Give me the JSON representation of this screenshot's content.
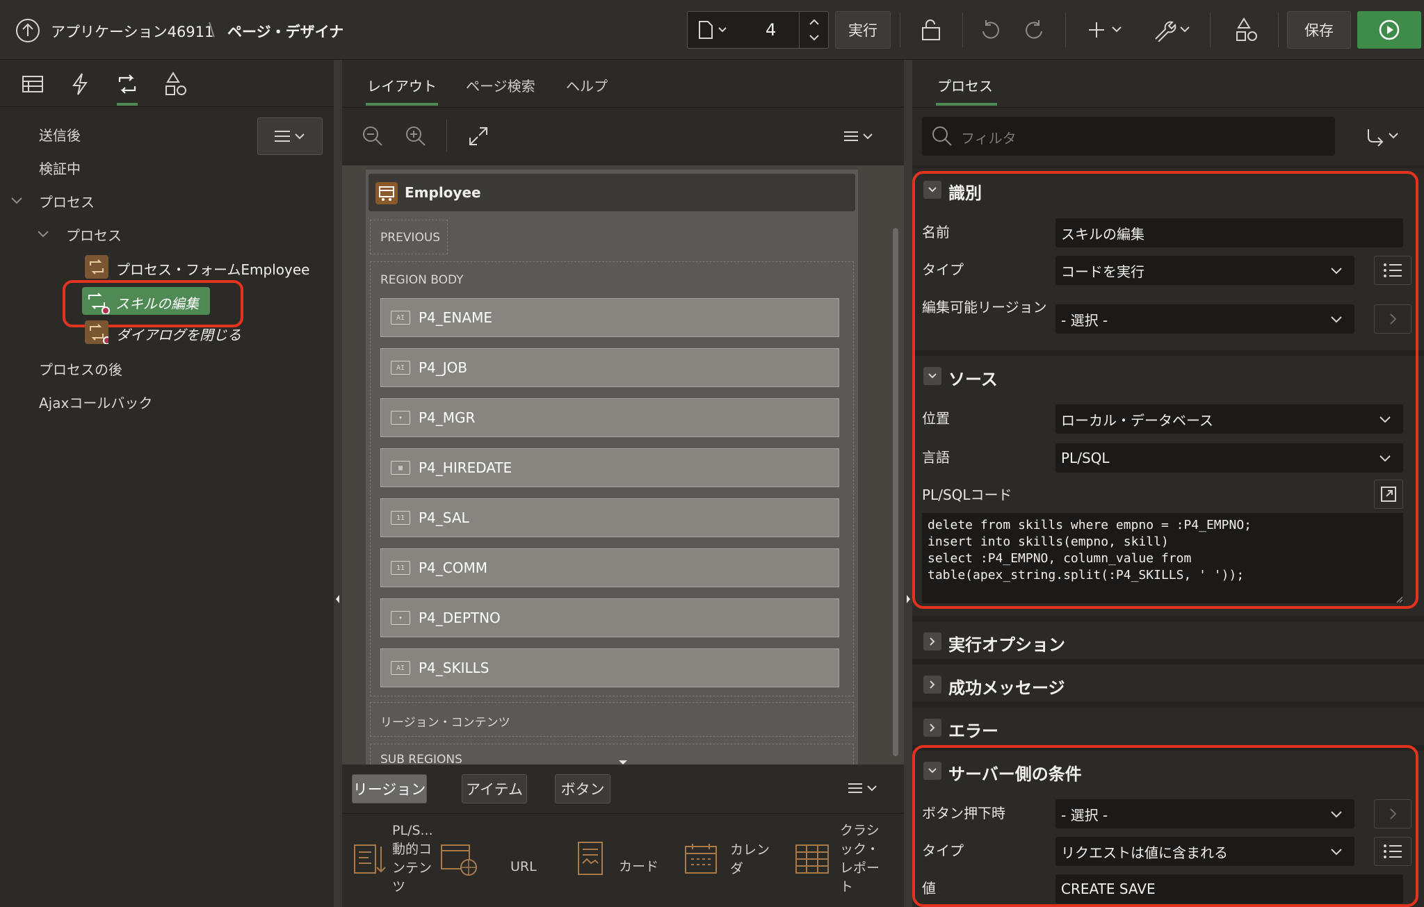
{
  "header": {
    "app_title": "アプリケーション46911",
    "separator": "\\",
    "page_designer": "ページ・デザイナ",
    "page_number": "4",
    "run_label": "実行",
    "save_label": "保存"
  },
  "left": {
    "tree": {
      "after_submit": "送信後",
      "validating": "検証中",
      "processing": "プロセス",
      "processes_group": "プロセス",
      "process_form": "プロセス・フォームEmployee",
      "edit_skills": "スキルの編集",
      "close_dialog": "ダイアログを閉じる",
      "after_processing": "プロセスの後",
      "ajax_callback": "Ajaxコールバック"
    }
  },
  "center": {
    "tabs": [
      "レイアウト",
      "ページ検索",
      "ヘルプ"
    ],
    "region_title": "Employee",
    "previous_label": "PREVIOUS",
    "region_body_label": "REGION BODY",
    "items": [
      "P4_ENAME",
      "P4_JOB",
      "P4_MGR",
      "P4_HIREDATE",
      "P4_SAL",
      "P4_COMM",
      "P4_DEPTNO",
      "P4_SKILLS"
    ],
    "region_content_label": "リージョン・コンテンツ",
    "sub_regions_label": "SUB REGIONS",
    "gallery_tabs": [
      "リージョン",
      "アイテム",
      "ボタン"
    ],
    "gallery": {
      "plsql": "PL/S...\n動的コ\nンテン\nツ",
      "url": "URL",
      "cards": "カード",
      "calendar": "カレン\nダ",
      "classic_report": "クラシ\nック・\nレポー\nト"
    }
  },
  "right": {
    "tab": "プロセス",
    "filter_placeholder": "フィルタ",
    "identification": {
      "title": "識別",
      "name_label": "名前",
      "name_value": "スキルの編集",
      "type_label": "タイプ",
      "type_value": "コードを実行",
      "editable_region_label": "編集可能リージョン",
      "editable_region_value": "- 選択 -"
    },
    "source": {
      "title": "ソース",
      "location_label": "位置",
      "location_value": "ローカル・データベース",
      "language_label": "言語",
      "language_value": "PL/SQL",
      "code_label": "PL/SQLコード",
      "code": "delete from skills where empno = :P4_EMPNO;\ninsert into skills(empno, skill)\nselect :P4_EMPNO, column_value from\ntable(apex_string.split(:P4_SKILLS, ' '));"
    },
    "execution_options": "実行オプション",
    "success_message": "成功メッセージ",
    "error": "エラー",
    "server_side_condition": {
      "title": "サーバー側の条件",
      "when_button_pressed_label": "ボタン押下時",
      "when_button_pressed_value": "- 選択 -",
      "type_label": "タイプ",
      "type_value": "リクエストは値に含まれる",
      "value_label": "値",
      "value_value": "CREATE SAVE"
    }
  },
  "colors": {
    "run_green": "#3f8b4a",
    "highlight_red": "#e3331f",
    "selected_green": "#4f8a55"
  }
}
